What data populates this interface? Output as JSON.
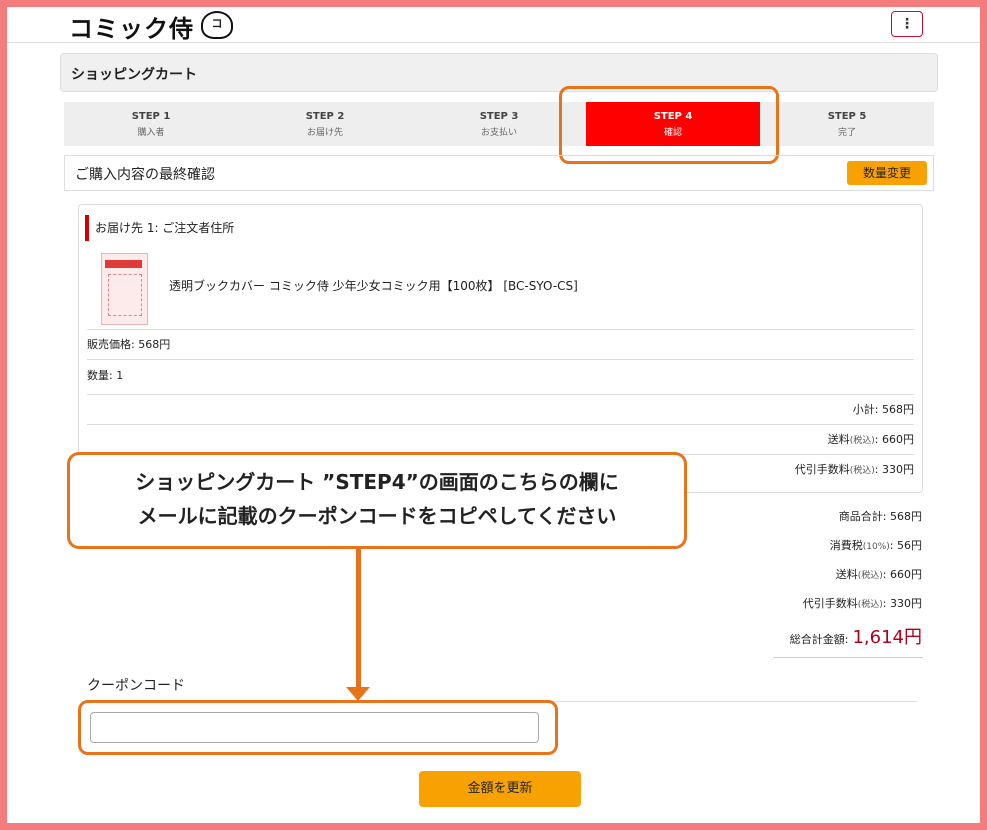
{
  "header": {
    "logo_text": "コミック侍",
    "logo_mark": "コ",
    "menu_icon": "⋮"
  },
  "page_title": "ショッピングカート",
  "steps": [
    {
      "num": "STEP 1",
      "label": "購入者"
    },
    {
      "num": "STEP 2",
      "label": "お届け先"
    },
    {
      "num": "STEP 3",
      "label": "お支払い"
    },
    {
      "num": "STEP 4",
      "label": "確認"
    },
    {
      "num": "STEP 5",
      "label": "完了"
    }
  ],
  "confirm": {
    "title": "ご購入内容の最終確認",
    "qty_button": "数量変更"
  },
  "order": {
    "destination": "お届け先 1: ご注文者住所",
    "product_name": "透明ブックカバー コミック侍 少年少女コミック用【100枚】 [BC-SYO-CS]",
    "price": "販売価格: 568円",
    "quantity": "数量: 1",
    "subtotal": "小計: 568円",
    "shipping_label": "送料",
    "shipping_tax": "(税込)",
    "shipping_value": ": 660円",
    "cod_label": "代引手数料",
    "cod_tax": "(税込)",
    "cod_value": ": 330円"
  },
  "summary": {
    "goods_total": "商品合計: 568円",
    "tax_label": "消費税",
    "tax_rate": "(10%)",
    "tax_value": ": 56円",
    "shipping_label": "送料",
    "shipping_tax": "(税込)",
    "shipping_value": ": 660円",
    "cod_label": "代引手数料",
    "cod_tax": "(税込)",
    "cod_value": ": 330円",
    "total_label": "総合計金額:",
    "total_value": "1,614円"
  },
  "callout": {
    "line1": "ショッピングカート ”STEP4”の画面のこちらの欄に",
    "line2": "メールに記載のクーポンコードをコピペしてください"
  },
  "coupon": {
    "label": "クーポンコード",
    "value": ""
  },
  "update_button": "金額を更新",
  "colors": {
    "active_step": "#ff0000",
    "accent_orange": "#e8731a",
    "button_orange": "#f7a200",
    "total_red": "#b0001e",
    "frame_pink": "#f47c7c"
  }
}
